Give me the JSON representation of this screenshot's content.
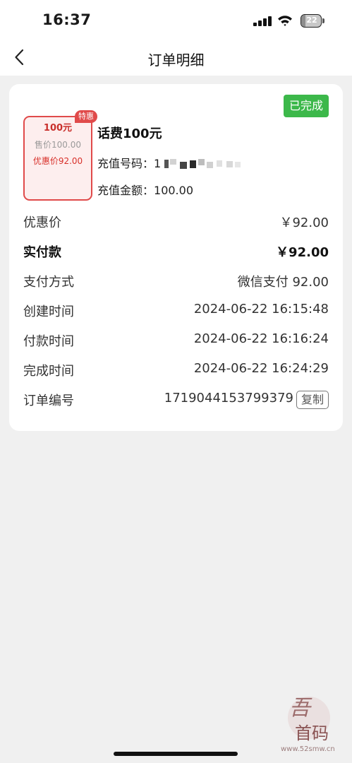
{
  "status_bar": {
    "time": "16:37",
    "battery": "22",
    "battery_level": 0.22,
    "icons": [
      "signal-icon",
      "wifi-icon",
      "battery-icon"
    ]
  },
  "nav": {
    "title": "订单明细",
    "back_icon": "chevron-left-icon"
  },
  "order": {
    "status": "已完成",
    "status_color": "#3cb84a",
    "coupon": {
      "tag": "特惠",
      "face_value": "100元",
      "price": "售价100.00",
      "discount_price": "优惠价92.00",
      "accent_color": "#e04a4a"
    },
    "product_name": "话费100元",
    "phone_label": "充值号码：",
    "phone_value": "1",
    "amount_label": "充值金额：",
    "amount_value": "100.00"
  },
  "details": [
    {
      "label": "优惠价",
      "value": "￥92.00"
    },
    {
      "label": "实付款",
      "value": "￥92.00"
    },
    {
      "label": "支付方式",
      "value": "微信支付 92.00"
    },
    {
      "label": "创建时间",
      "value": "2024-06-22 16:15:48"
    },
    {
      "label": "付款时间",
      "value": "2024-06-22 16:16:24"
    },
    {
      "label": "完成时间",
      "value": "2024-06-22 16:24:29"
    },
    {
      "label": "订单编号",
      "value": "1719044153799379"
    }
  ],
  "copy_label": "复制",
  "watermark": {
    "glyph_top": "吾",
    "glyph_bottom": "首码",
    "site": "www.52smw.cn"
  }
}
